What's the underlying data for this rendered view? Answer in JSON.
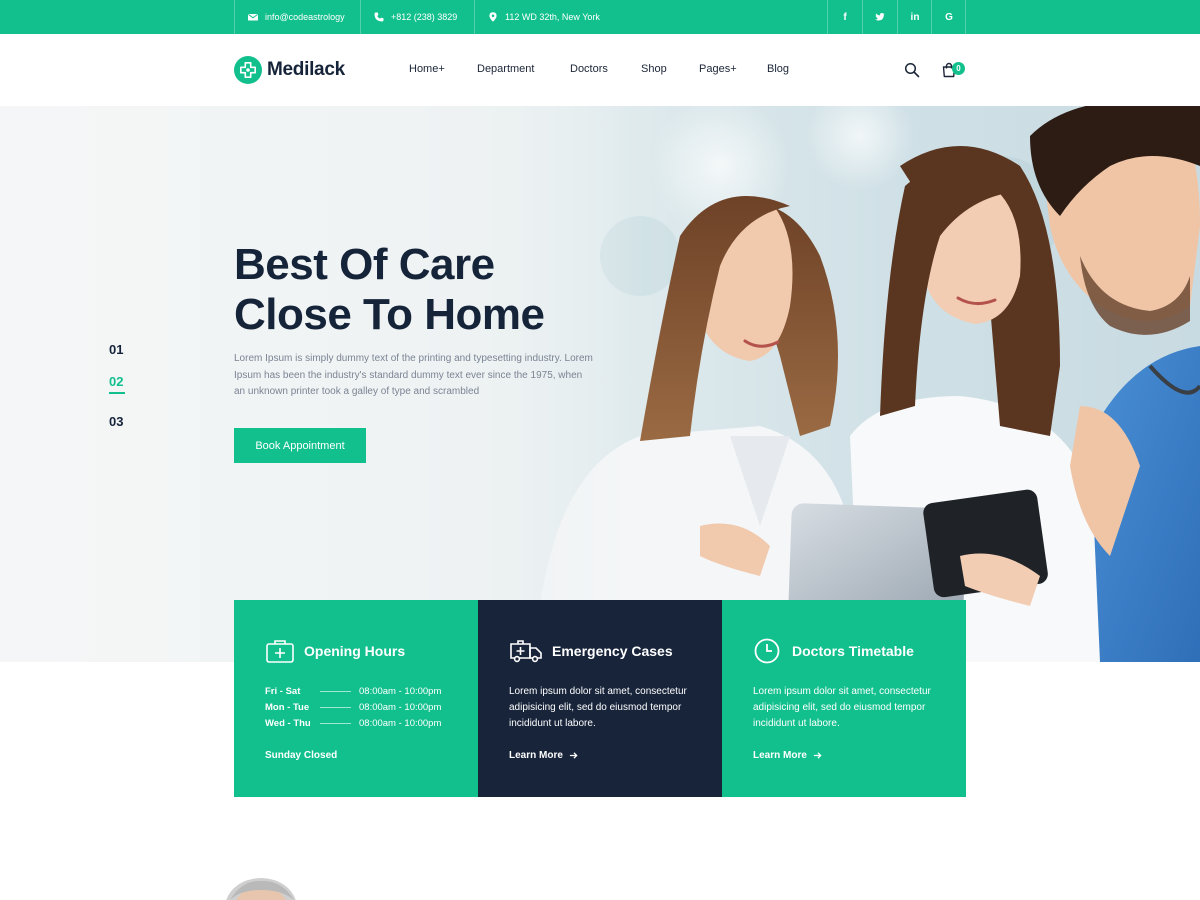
{
  "topbar": {
    "email": "info@codeastrology",
    "phone": "+812 (238) 3829",
    "address": "112 WD 32th, New York",
    "social": [
      {
        "icon": "facebook-icon",
        "glyph": "f"
      },
      {
        "icon": "twitter-icon",
        "glyph": "t"
      },
      {
        "icon": "linkedin-icon",
        "glyph": "in"
      },
      {
        "icon": "google-icon",
        "glyph": "G"
      }
    ]
  },
  "header": {
    "brand": "Medilack",
    "nav": [
      "Home+",
      "Department",
      "Doctors",
      "Shop",
      "Pages+",
      "Blog"
    ],
    "cart_count": "0"
  },
  "hero": {
    "title_line1": "Best Of Care",
    "title_line2": "Close To Home",
    "description": "Lorem Ipsum is simply dummy text of the printing and typesetting industry. Lorem Ipsum has been the industry's standard dummy text ever since the 1975, when an unknown printer took a galley of type and scrambled",
    "button": "Book Appointment",
    "slides": [
      "01",
      "02",
      "03"
    ],
    "active_slide": "02"
  },
  "boxes": {
    "opening": {
      "title": "Opening Hours",
      "rows": [
        {
          "day": "Fri - Sat",
          "time": "08:00am - 10:00pm"
        },
        {
          "day": "Mon - Tue",
          "time": "08:00am - 10:00pm"
        },
        {
          "day": "Wed - Thu",
          "time": "08:00am - 10:00pm"
        }
      ],
      "closed": "Sunday Closed"
    },
    "emergency": {
      "title": "Emergency Cases",
      "text": "Lorem ipsum dolor sit amet, consectetur adipisicing elit, sed do eiusmod tempor incididunt ut labore.",
      "link": "Learn More"
    },
    "timetable": {
      "title": "Doctors Timetable",
      "text": "Lorem ipsum dolor sit amet, consectetur adipisicing elit, sed do eiusmod tempor incididunt ut labore.",
      "link": "Learn More"
    }
  },
  "colors": {
    "accent": "#12c08d",
    "dark": "#18243a",
    "heading": "#16243a",
    "muted": "#7b8494"
  }
}
